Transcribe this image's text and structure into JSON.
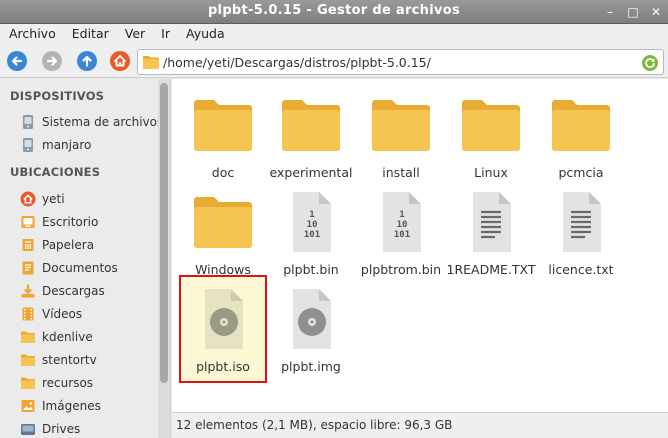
{
  "window": {
    "title": "plpbt-5.0.15 - Gestor de archivos"
  },
  "menu": [
    "Archivo",
    "Editar",
    "Ver",
    "Ir",
    "Ayuda"
  ],
  "location": {
    "path": "/home/yeti/Descargas/distros/plpbt-5.0.15/"
  },
  "sidebar": {
    "devices_heading": "DISPOSITIVOS",
    "devices": [
      {
        "label": "Sistema de archivos",
        "icon": "drive-icon"
      },
      {
        "label": "manjaro",
        "icon": "drive-icon"
      }
    ],
    "places_heading": "UBICACIONES",
    "places": [
      {
        "label": "yeti",
        "icon": "home-icon"
      },
      {
        "label": "Escritorio",
        "icon": "desktop-icon"
      },
      {
        "label": "Papelera",
        "icon": "trash-icon"
      },
      {
        "label": "Documentos",
        "icon": "documents-icon"
      },
      {
        "label": "Descargas",
        "icon": "downloads-icon"
      },
      {
        "label": "Vídeos",
        "icon": "videos-icon"
      },
      {
        "label": "kdenlive",
        "icon": "folder-icon"
      },
      {
        "label": "stentortv",
        "icon": "folder-icon"
      },
      {
        "label": "recursos",
        "icon": "folder-icon"
      },
      {
        "label": "Imágenes",
        "icon": "pictures-icon"
      },
      {
        "label": "Drives",
        "icon": "drive-icon"
      }
    ]
  },
  "files": [
    {
      "name": "doc",
      "kind": "folder"
    },
    {
      "name": "experimental",
      "kind": "folder"
    },
    {
      "name": "install",
      "kind": "folder"
    },
    {
      "name": "Linux",
      "kind": "folder"
    },
    {
      "name": "pcmcia",
      "kind": "folder"
    },
    {
      "name": "Windows",
      "kind": "folder"
    },
    {
      "name": "plpbt.bin",
      "kind": "binary"
    },
    {
      "name": "plpbtrom.bin",
      "kind": "binary"
    },
    {
      "name": "1README.TXT",
      "kind": "text"
    },
    {
      "name": "licence.txt",
      "kind": "text"
    },
    {
      "name": "plpbt.iso",
      "kind": "disc",
      "selected": true
    },
    {
      "name": "plpbt.img",
      "kind": "disc"
    }
  ],
  "status": {
    "text": "12 elementos (2,1 MB), espacio libre: 96,3 GB"
  },
  "colors": {
    "folder": "#f5c451",
    "folder_dark": "#e8ac35",
    "accent": "#3a86d4",
    "home": "#e85a2a",
    "selection_border": "#e0101a"
  }
}
